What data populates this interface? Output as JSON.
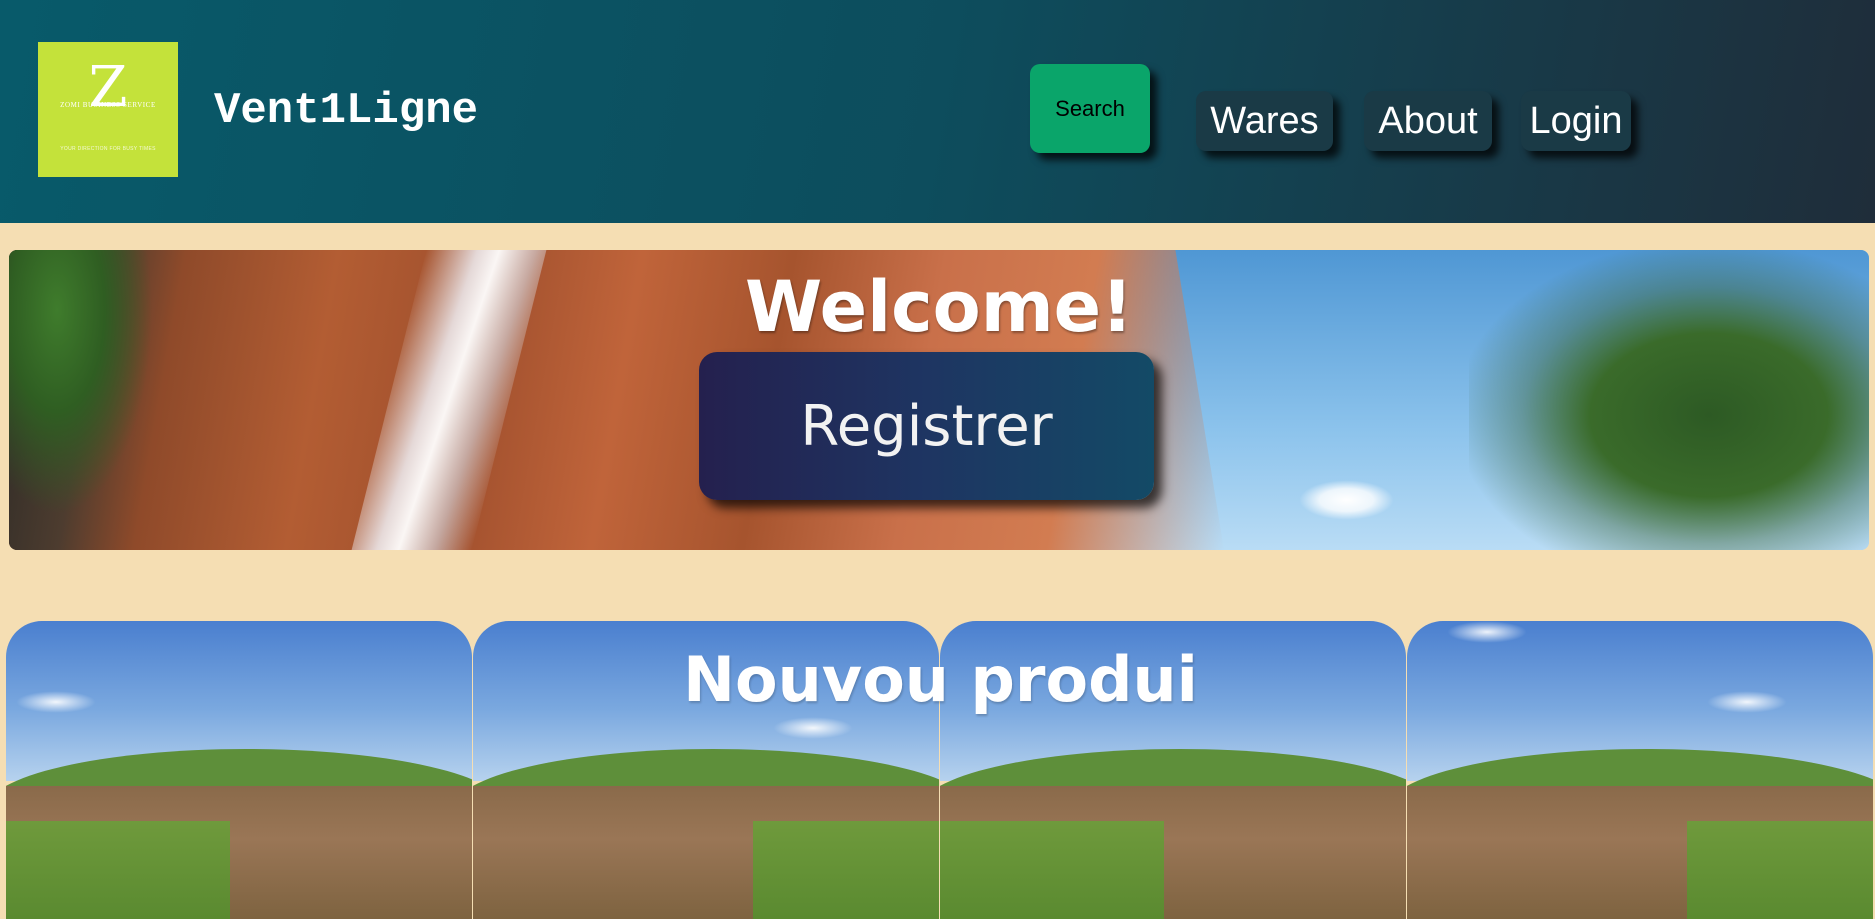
{
  "header": {
    "logo": {
      "letter": "Z",
      "line": "ZOMI BUSINESS SERVICE",
      "tagline": "YOUR DIRECTION FOR BUSY TIMES"
    },
    "site_title": "Vent1Ligne",
    "search_label": "Search",
    "nav": [
      {
        "label": "Wares"
      },
      {
        "label": "About"
      },
      {
        "label": "Login"
      }
    ]
  },
  "hero": {
    "title": "Welcome!",
    "register_label": "Registrer"
  },
  "products": {
    "title": "Nouvou produi",
    "cards": [
      {
        "name": "product-card-1"
      },
      {
        "name": "product-card-2"
      },
      {
        "name": "product-card-3"
      },
      {
        "name": "product-card-4"
      }
    ]
  },
  "colors": {
    "page_background": "#f5deb3",
    "header_start": "#085a6a",
    "header_end": "#1f2d3a",
    "search_button": "#0aa56a",
    "nav_button": "#1a3a46",
    "logo_background": "#c4e23a"
  }
}
